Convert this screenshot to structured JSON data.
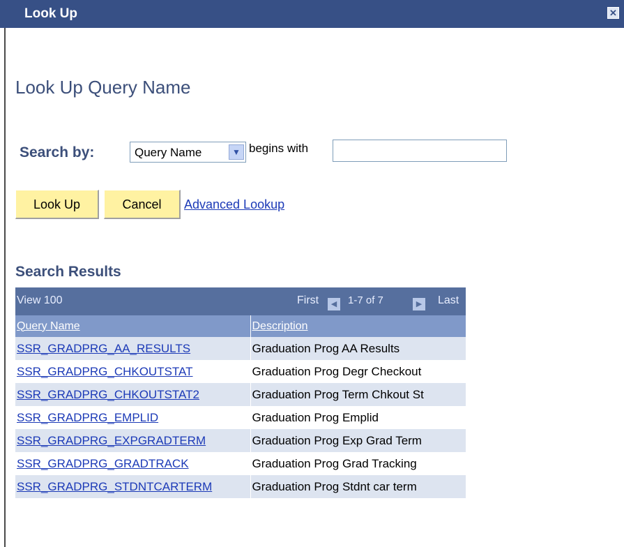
{
  "window": {
    "title": "Look Up",
    "close_icon": "close-icon"
  },
  "page_title": "Look Up Query Name",
  "search": {
    "label": "Search by:",
    "field_selected": "Query Name",
    "operator_text": "begins with",
    "value": ""
  },
  "buttons": {
    "lookup": "Look Up",
    "cancel": "Cancel",
    "advanced": "Advanced Lookup"
  },
  "results": {
    "title": "Search Results",
    "nav": {
      "view": "View 100",
      "first": "First",
      "range": "1-7 of 7",
      "last": "Last"
    },
    "columns": [
      "Query Name",
      "Description"
    ],
    "rows": [
      {
        "name": "SSR_GRADPRG_AA_RESULTS",
        "description": "Graduation Prog AA Results"
      },
      {
        "name": "SSR_GRADPRG_CHKOUTSTAT",
        "description": "Graduation Prog Degr Checkout"
      },
      {
        "name": "SSR_GRADPRG_CHKOUTSTAT2",
        "description": "Graduation Prog Term Chkout St"
      },
      {
        "name": "SSR_GRADPRG_EMPLID",
        "description": "Graduation Prog Emplid"
      },
      {
        "name": "SSR_GRADPRG_EXPGRADTERM",
        "description": "Graduation Prog Exp Grad Term"
      },
      {
        "name": "SSR_GRADPRG_GRADTRACK",
        "description": "Graduation Prog  Grad Tracking"
      },
      {
        "name": "SSR_GRADPRG_STDNTCARTERM",
        "description": "Graduation Prog Stdnt car term"
      }
    ]
  },
  "colors": {
    "titlebar": "#375086",
    "grid_nav": "#566f9e",
    "grid_header": "#8099c9",
    "row_alt": "#dde4f0",
    "button": "#fff2a2",
    "link": "#1c3ab7"
  }
}
